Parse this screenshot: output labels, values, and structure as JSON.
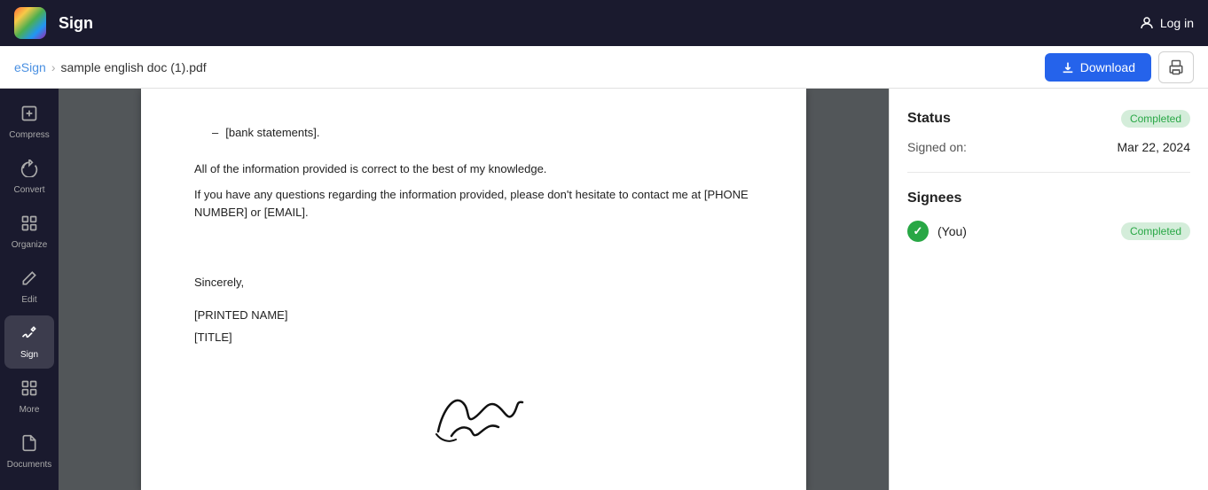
{
  "topbar": {
    "title": "Sign",
    "login_label": "Log in"
  },
  "breadcrumb": {
    "parent": "eSign",
    "separator": "›",
    "current": "sample english doc (1).pdf"
  },
  "toolbar": {
    "download_label": "Download",
    "print_label": "Print"
  },
  "sidebar": {
    "items": [
      {
        "id": "compress",
        "label": "Compress",
        "icon": "⬡"
      },
      {
        "id": "convert",
        "label": "Convert",
        "icon": "⟳"
      },
      {
        "id": "organize",
        "label": "Organize",
        "icon": "⊞"
      },
      {
        "id": "edit",
        "label": "Edit",
        "icon": "T"
      },
      {
        "id": "sign",
        "label": "Sign",
        "icon": "✒",
        "active": true
      },
      {
        "id": "more",
        "label": "More",
        "icon": "⊞"
      },
      {
        "id": "documents",
        "label": "Documents",
        "icon": "📄"
      }
    ]
  },
  "pdf": {
    "bullet_text": "[bank statements].",
    "paragraph1": "All of the information provided is correct to the best of my knowledge.",
    "paragraph2": "If you have any questions regarding the information provided, please don't hesitate to contact me at [PHONE NUMBER] or [EMAIL].",
    "sincerely": "Sincerely,",
    "printed_name": "[PRINTED NAME]",
    "title": "[TITLE]"
  },
  "right_panel": {
    "status_section": {
      "title": "Status",
      "badge": "Completed",
      "signed_on_label": "Signed on:",
      "signed_on_value": "Mar 22, 2024"
    },
    "signees_section": {
      "title": "Signees",
      "signees": [
        {
          "name": "(You)",
          "badge": "Completed"
        }
      ]
    }
  }
}
